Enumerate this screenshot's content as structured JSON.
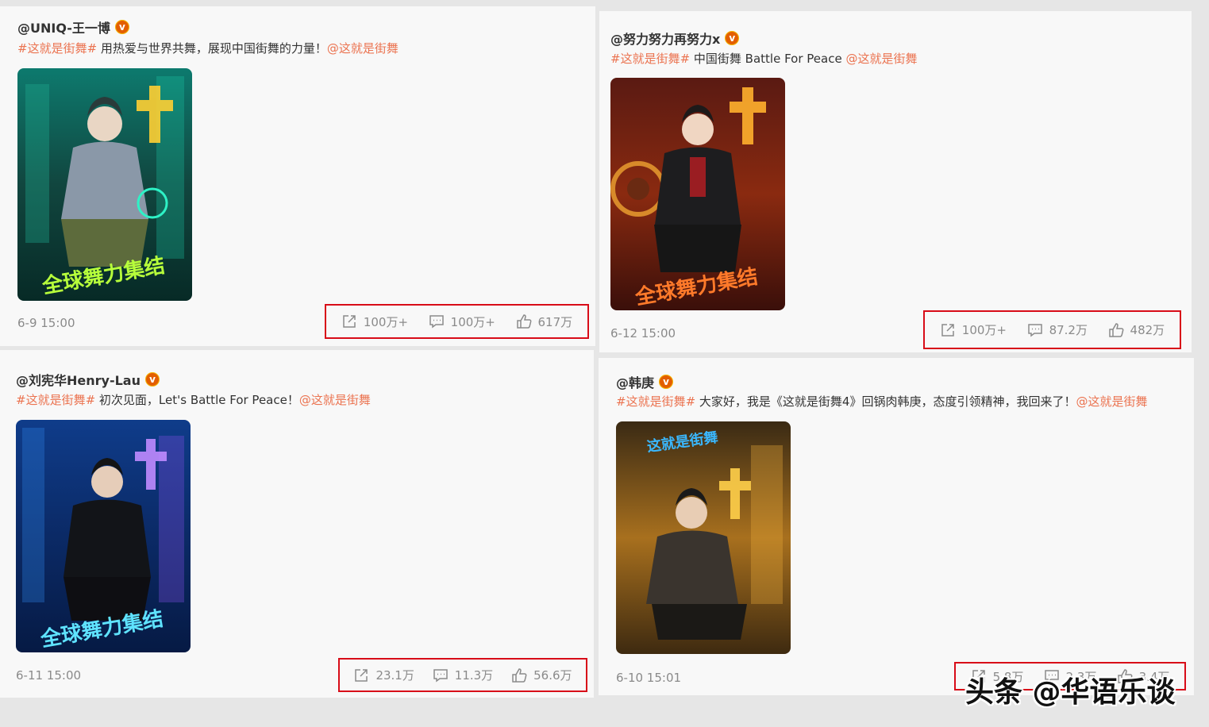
{
  "posts": [
    {
      "author": "@UNIQ-王一博",
      "verified_glyph": "v",
      "hashtag": "#这就是街舞#",
      "body": " 用热爱与世界共舞，展现中国街舞的力量！",
      "mention": "@这就是街舞",
      "poster_theme": "green-neon",
      "timestamp": "6-9 15:00",
      "repost": "100万+",
      "comment": "100万+",
      "like": "617万",
      "poster_slogan": "全球舞力集结"
    },
    {
      "author": "@努力努力再努力x",
      "verified_glyph": "v",
      "hashtag": "#这就是街舞#",
      "body": " 中国街舞 Battle For Peace ",
      "mention": "@这就是街舞",
      "poster_theme": "red-orange",
      "timestamp": "6-12 15:00",
      "repost": "100万+",
      "comment": "87.2万",
      "like": "482万",
      "poster_slogan": "全球舞力集结"
    },
    {
      "author": "@刘宪华Henry-Lau",
      "verified_glyph": "v",
      "hashtag": "#这就是街舞#",
      "body": " 初次见面，Let's Battle For Peace！",
      "mention": "@这就是街舞",
      "poster_theme": "blue-neon",
      "timestamp": "6-11 15:00",
      "repost": "23.1万",
      "comment": "11.3万",
      "like": "56.6万",
      "poster_slogan": "全球舞力集结"
    },
    {
      "author": "@韩庚",
      "verified_glyph": "v",
      "hashtag": "#这就是街舞#",
      "body": " 大家好，我是《这就是街舞4》回锅肉韩庚，态度引领精神，我回来了！",
      "mention": "@这就是街舞",
      "poster_theme": "gold-amber",
      "timestamp": "6-10 15:01",
      "repost": "5.8万",
      "comment": "2.3万",
      "like": "3.4万",
      "poster_slogan": "这就是街舞"
    }
  ],
  "watermark": "头条 @华语乐谈",
  "colors": {
    "tag": "#eb7350",
    "highlight_box": "#d80c18",
    "card_bg": "#f8f8f8",
    "page_bg": "#e6e6e6"
  }
}
